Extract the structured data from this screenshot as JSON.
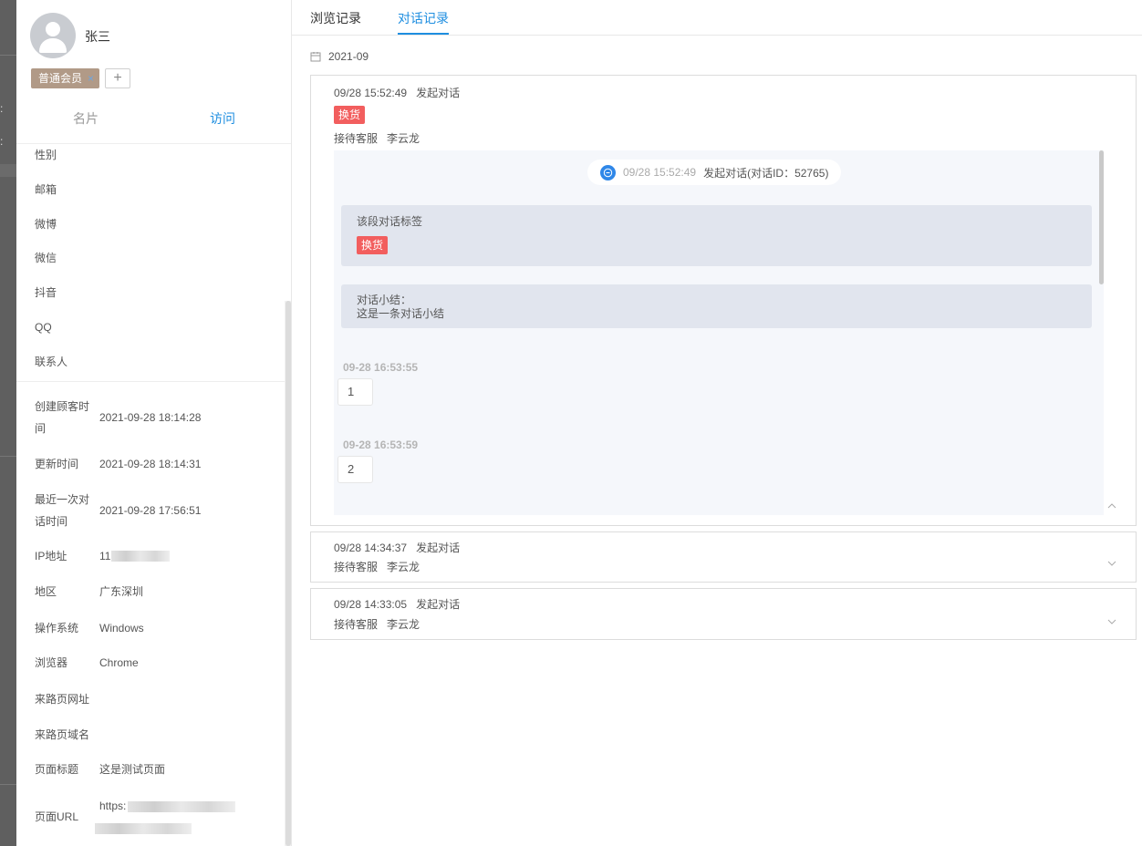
{
  "profile": {
    "name": "张三",
    "member_tag": "普通会员",
    "tag_remove": "×",
    "tag_add": "+",
    "tabs": {
      "card": "名片",
      "visit": "访问"
    }
  },
  "contact_fields": [
    {
      "label": "性别"
    },
    {
      "label": "邮箱"
    },
    {
      "label": "微博"
    },
    {
      "label": "微信"
    },
    {
      "label": "抖音"
    },
    {
      "label": "QQ"
    },
    {
      "label": "联系人"
    }
  ],
  "visit_fields": {
    "created": {
      "label_1": "创建顾客时",
      "label_2": "间",
      "value": "2021-09-28 18:14:28"
    },
    "updated": {
      "label": "更新时间",
      "value": "2021-09-28 18:14:31"
    },
    "last_chat": {
      "label_1": "最近一次对",
      "label_2": "话时间",
      "value": "2021-09-28 17:56:51"
    },
    "ip": {
      "label": "IP地址",
      "value": "11"
    },
    "region": {
      "label": "地区",
      "value": "广东深圳"
    },
    "os": {
      "label": "操作系统",
      "value": "Windows"
    },
    "browser": {
      "label": "浏览器",
      "value": "Chrome"
    },
    "referrer_url": {
      "label": "来路页网址"
    },
    "referrer_domain": {
      "label": "来路页域名"
    },
    "page_title": {
      "label": "页面标题",
      "value": "这是测试页面"
    },
    "page_url": {
      "label": "页面URL",
      "value": "https:"
    }
  },
  "tabs": {
    "browse": "浏览记录",
    "chat": "对话记录"
  },
  "month": "2021-09",
  "sessions": [
    {
      "time": "09/28 15:52:49",
      "action": "发起对话",
      "tag": "换货",
      "agent_label": "接待客服",
      "agent": "李云龙",
      "transcript": {
        "system_time": "09/28 15:52:49",
        "system_text": "发起对话(对话ID：52765)",
        "tag_title": "该段对话标签",
        "tag": "换货",
        "summary_label": "对话小结：",
        "summary_text": "这是一条对话小结",
        "messages": [
          {
            "time": "09-28 16:53:55",
            "text": "1"
          },
          {
            "time": "09-28 16:53:59",
            "text": "2"
          }
        ]
      }
    },
    {
      "time": "09/28 14:34:37",
      "action": "发起对话",
      "agent_label": "接待客服",
      "agent": "李云龙"
    },
    {
      "time": "09/28 14:33:05",
      "action": "发起对话",
      "agent_label": "接待客服",
      "agent": "李云龙"
    }
  ],
  "colors": {
    "accent": "#1e8ee0",
    "tag_red": "#f25e5e",
    "member_tag": "#b19a87"
  }
}
